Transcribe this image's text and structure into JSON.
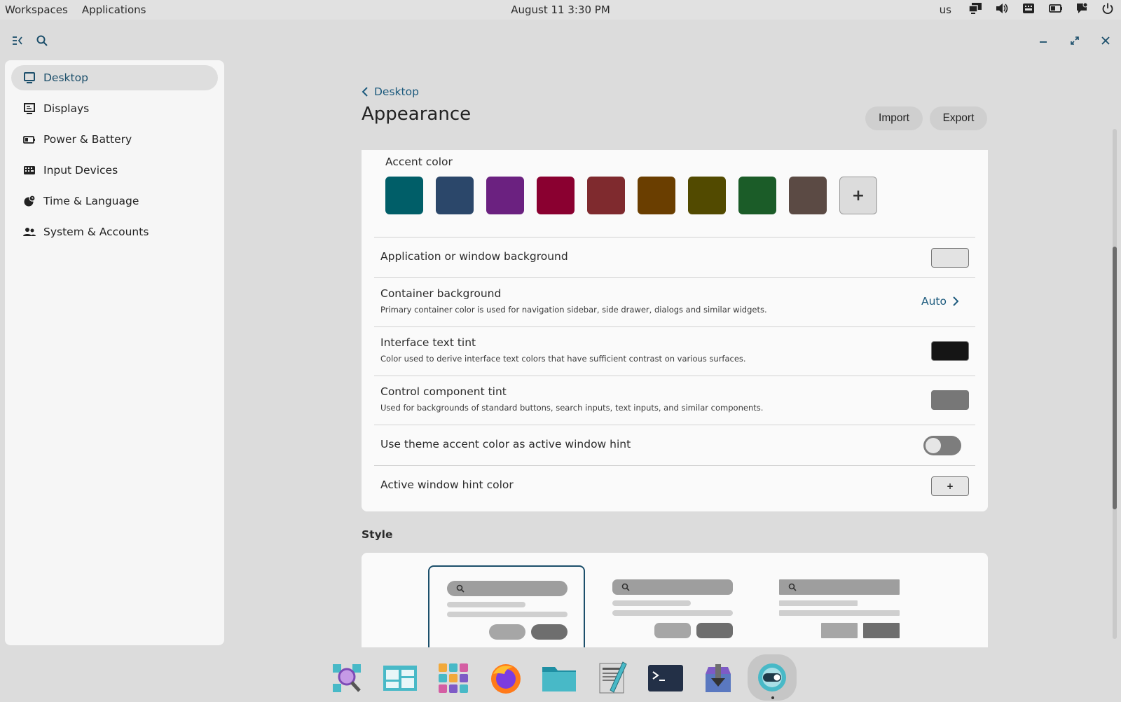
{
  "topbar": {
    "workspaces": "Workspaces",
    "applications": "Applications",
    "clock": "August 11 3:30 PM",
    "keyboard_layout": "us",
    "tray_icons": [
      "display-icon",
      "volume-icon",
      "keyboard-icon",
      "battery-icon",
      "notification-icon",
      "power-icon"
    ]
  },
  "window": {
    "sidebar": {
      "items": [
        {
          "label": "Desktop",
          "icon": "monitor-icon",
          "active": true
        },
        {
          "label": "Displays",
          "icon": "displays-icon",
          "active": false
        },
        {
          "label": "Power & Battery",
          "icon": "battery-icon",
          "active": false
        },
        {
          "label": "Input Devices",
          "icon": "keyboard-icon",
          "active": false
        },
        {
          "label": "Time & Language",
          "icon": "globe-clock-icon",
          "active": false
        },
        {
          "label": "System & Accounts",
          "icon": "users-icon",
          "active": false
        }
      ]
    },
    "breadcrumb": "Desktop",
    "title": "Appearance",
    "import_label": "Import",
    "export_label": "Export",
    "accent": {
      "title": "Accent color",
      "colors": [
        "#005e68",
        "#2b476a",
        "#6b2180",
        "#8a0030",
        "#7f2a2e",
        "#6a3e00",
        "#524a00",
        "#1b5c28",
        "#5b4a44"
      ],
      "add_label": "+"
    },
    "rows": {
      "window_bg": {
        "label": "Application or window background",
        "color": "#e3e3e3"
      },
      "container_bg": {
        "label": "Container background",
        "desc": "Primary container color is used for navigation sidebar, side drawer, dialogs and similar widgets.",
        "value": "Auto"
      },
      "text_tint": {
        "label": "Interface text tint",
        "desc": "Color used to derive interface text colors that have sufficient contrast on various surfaces.",
        "color": "#151515"
      },
      "control_tint": {
        "label": "Control component tint",
        "desc": "Used for backgrounds of standard buttons, search inputs, text inputs, and similar components.",
        "color": "#777777"
      },
      "theme_hint": {
        "label": "Use theme accent color as active window hint",
        "enabled": false
      },
      "hint_color": {
        "label": "Active window hint color",
        "add_label": "+"
      }
    },
    "style": {
      "title": "Style",
      "options": [
        "round",
        "slightly-round",
        "square"
      ],
      "selected": 0
    }
  },
  "dock": {
    "apps": [
      "launcher-icon",
      "workspaces-icon",
      "app-grid-icon",
      "firefox-icon",
      "files-icon",
      "text-editor-icon",
      "terminal-icon",
      "store-icon",
      "settings-icon"
    ]
  }
}
